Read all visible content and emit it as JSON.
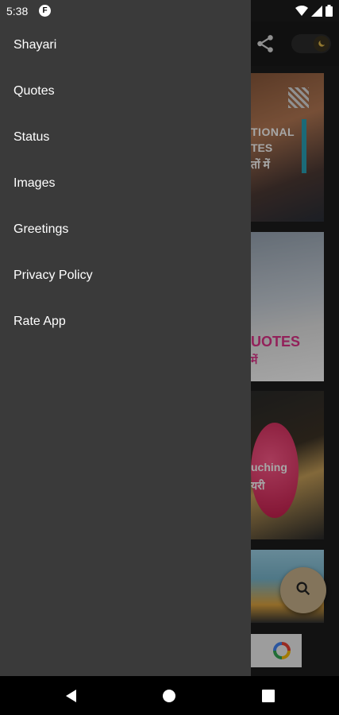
{
  "status_bar": {
    "time": "5:38",
    "app_icon_letter": "F",
    "icons": [
      "wifi-icon",
      "signal-icon",
      "battery-icon"
    ]
  },
  "drawer": {
    "items": [
      {
        "label": "Shayari"
      },
      {
        "label": "Quotes"
      },
      {
        "label": "Status"
      },
      {
        "label": "Images"
      },
      {
        "label": "Greetings"
      },
      {
        "label": "Privacy Policy"
      },
      {
        "label": "Rate App"
      }
    ]
  },
  "background": {
    "cards": [
      {
        "lines": [
          "TIONAL",
          "TES",
          "तों में"
        ]
      },
      {
        "lines": [
          "UOTES",
          "में"
        ]
      },
      {
        "lines": [
          "uching",
          "यरी"
        ]
      },
      {
        "lines": []
      }
    ]
  },
  "colors": {
    "drawer_bg": "#3a3a3a",
    "fab_bg": "#c9b28c",
    "accent_pink": "#e0338a"
  },
  "icons": {
    "share": "share-icon",
    "toggle": "moon-icon",
    "fab": "search-icon",
    "nav": [
      "back-icon",
      "home-icon",
      "recents-icon"
    ]
  }
}
